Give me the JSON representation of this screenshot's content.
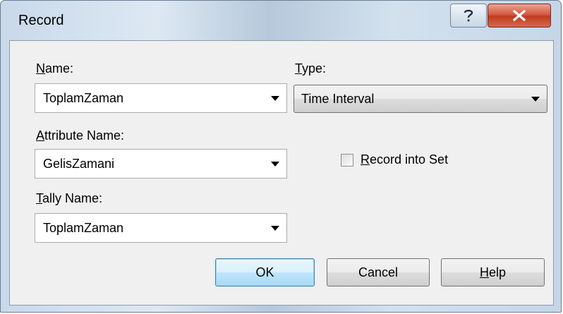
{
  "window": {
    "title": "Record"
  },
  "fields": {
    "name": {
      "label_mnemonic": "N",
      "label_rest": "ame:",
      "value": "ToplamZaman"
    },
    "type": {
      "label_mnemonic": "T",
      "label_rest": "ype:",
      "value": "Time Interval"
    },
    "attribute_name": {
      "label_mnemonic": "A",
      "label_rest": "ttribute Name:",
      "value": "GelisZamani"
    },
    "tally_name": {
      "label_mnemonic": "T",
      "label_rest": "ally Name:",
      "value": "ToplamZaman"
    }
  },
  "record_into_set": {
    "label_mnemonic": "R",
    "label_rest": "ecord into Set",
    "checked": false
  },
  "buttons": {
    "ok": "OK",
    "cancel": "Cancel",
    "help_mnemonic": "H",
    "help_rest": "elp"
  },
  "icons": {
    "help": "question-mark-icon",
    "close": "close-x-icon",
    "dropdown": "triangle-down-icon"
  },
  "colors": {
    "close_button": "#c8432b",
    "default_button_border": "#3c7fb1",
    "dialog_background": "#f0f0f0"
  }
}
